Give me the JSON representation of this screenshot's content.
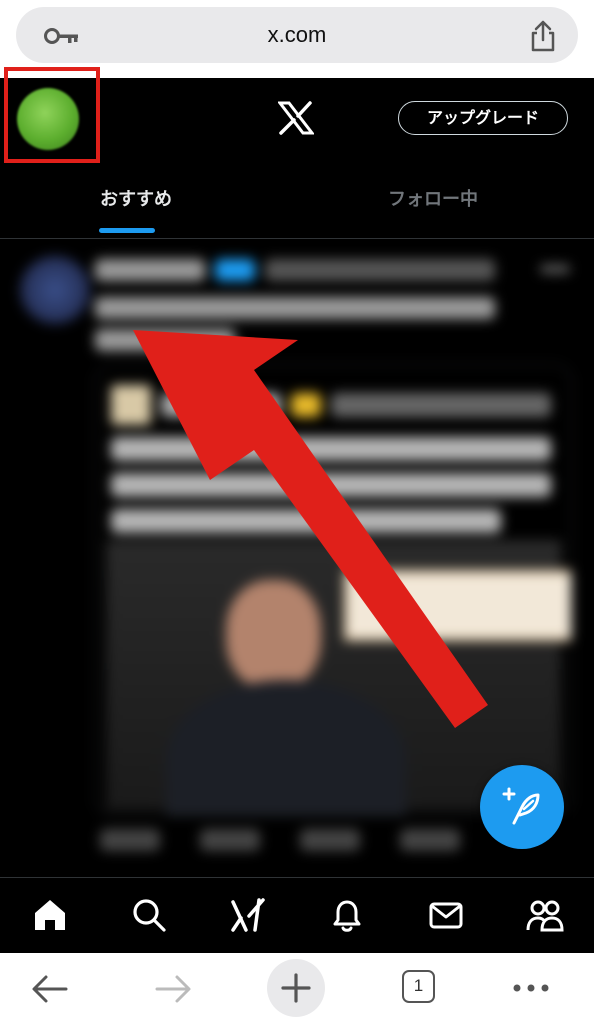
{
  "browser": {
    "url": "x.com",
    "open_tabs": "1"
  },
  "header": {
    "upgrade_label": "アップグレード"
  },
  "tabs": [
    {
      "label": "おすすめ",
      "active": true
    },
    {
      "label": "フォロー中",
      "active": false
    }
  ],
  "icons": {
    "address_bar": [
      "key-icon",
      "share-icon"
    ],
    "bottom_nav": [
      "home-icon",
      "search-icon",
      "grok-icon",
      "notifications-icon",
      "messages-icon",
      "communities-icon"
    ],
    "browser_toolbar": [
      "back-arrow-icon",
      "forward-arrow-icon",
      "new-tab-plus-icon",
      "tab-count-icon",
      "more-dots-icon"
    ]
  },
  "colors": {
    "accent": "#1d9bf0",
    "annotation_red": "#e0201a",
    "background": "#000000"
  }
}
